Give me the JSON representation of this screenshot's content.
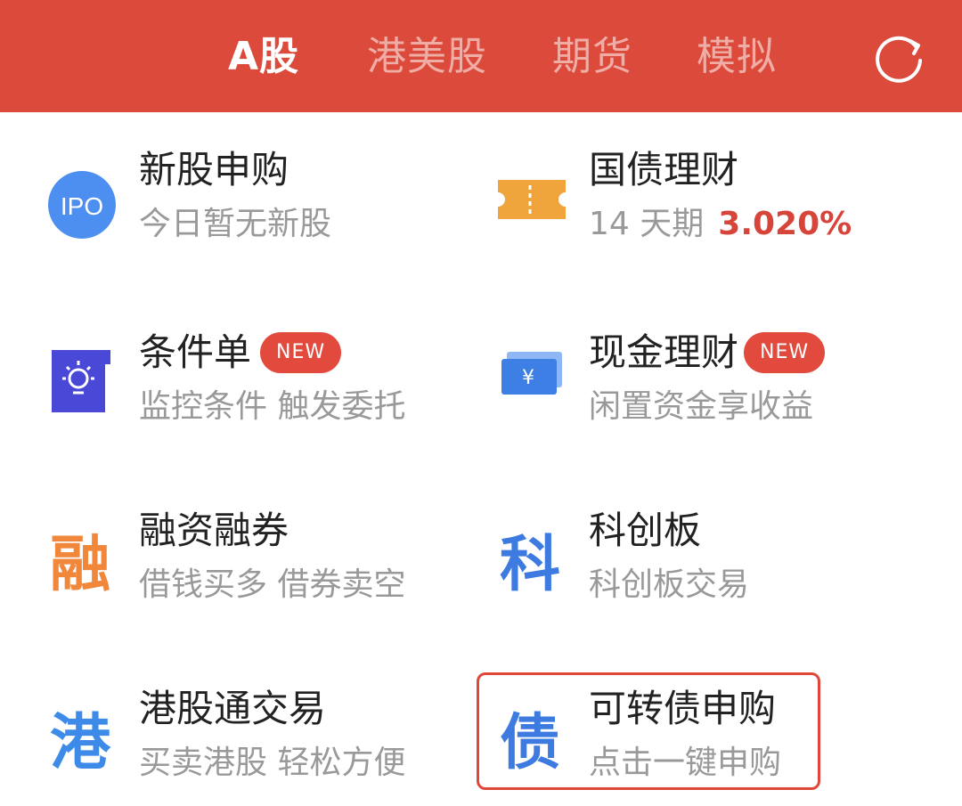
{
  "tabs": [
    {
      "label": "A股",
      "active": true
    },
    {
      "label": "港美股",
      "active": false
    },
    {
      "label": "期货",
      "active": false
    },
    {
      "label": "模拟",
      "active": false
    }
  ],
  "colors": {
    "header_bg": "#db4a3b",
    "accent_red": "#e14a3c",
    "title_text": "#222222",
    "subtitle_text": "#999999"
  },
  "icons": {
    "refresh": "refresh-icon",
    "ipo": "ipo-icon",
    "treasury": "ticket-icon",
    "conditional": "lightbulb-icon",
    "cash": "yen-card-icon",
    "margin": "rong-glyph-icon",
    "star_board": "ke-glyph-icon",
    "hk_connect": "gang-glyph-icon",
    "convertible": "zhai-glyph-icon"
  },
  "ipo_label": "IPO",
  "glyphs": {
    "margin": "融",
    "star_board": "科",
    "hk_connect": "港",
    "convertible": "债"
  },
  "menu": {
    "ipo": {
      "title": "新股申购",
      "subtitle": "今日暂无新股"
    },
    "treasury": {
      "title": "国债理财",
      "subtitle_term": "14 天期",
      "subtitle_rate": "3.020%"
    },
    "conditional": {
      "title": "条件单",
      "badge": "NEW",
      "subtitle": "监控条件 触发委托"
    },
    "cash": {
      "title": "现金理财",
      "badge": "NEW",
      "subtitle": "闲置资金享收益"
    },
    "margin": {
      "title": "融资融券",
      "subtitle": "借钱买多 借券卖空"
    },
    "star_board": {
      "title": "科创板",
      "subtitle": "科创板交易"
    },
    "hk_connect": {
      "title": "港股通交易",
      "subtitle": "买卖港股 轻松方便"
    },
    "convertible": {
      "title": "可转债申购",
      "subtitle": "点击一键申购"
    }
  }
}
